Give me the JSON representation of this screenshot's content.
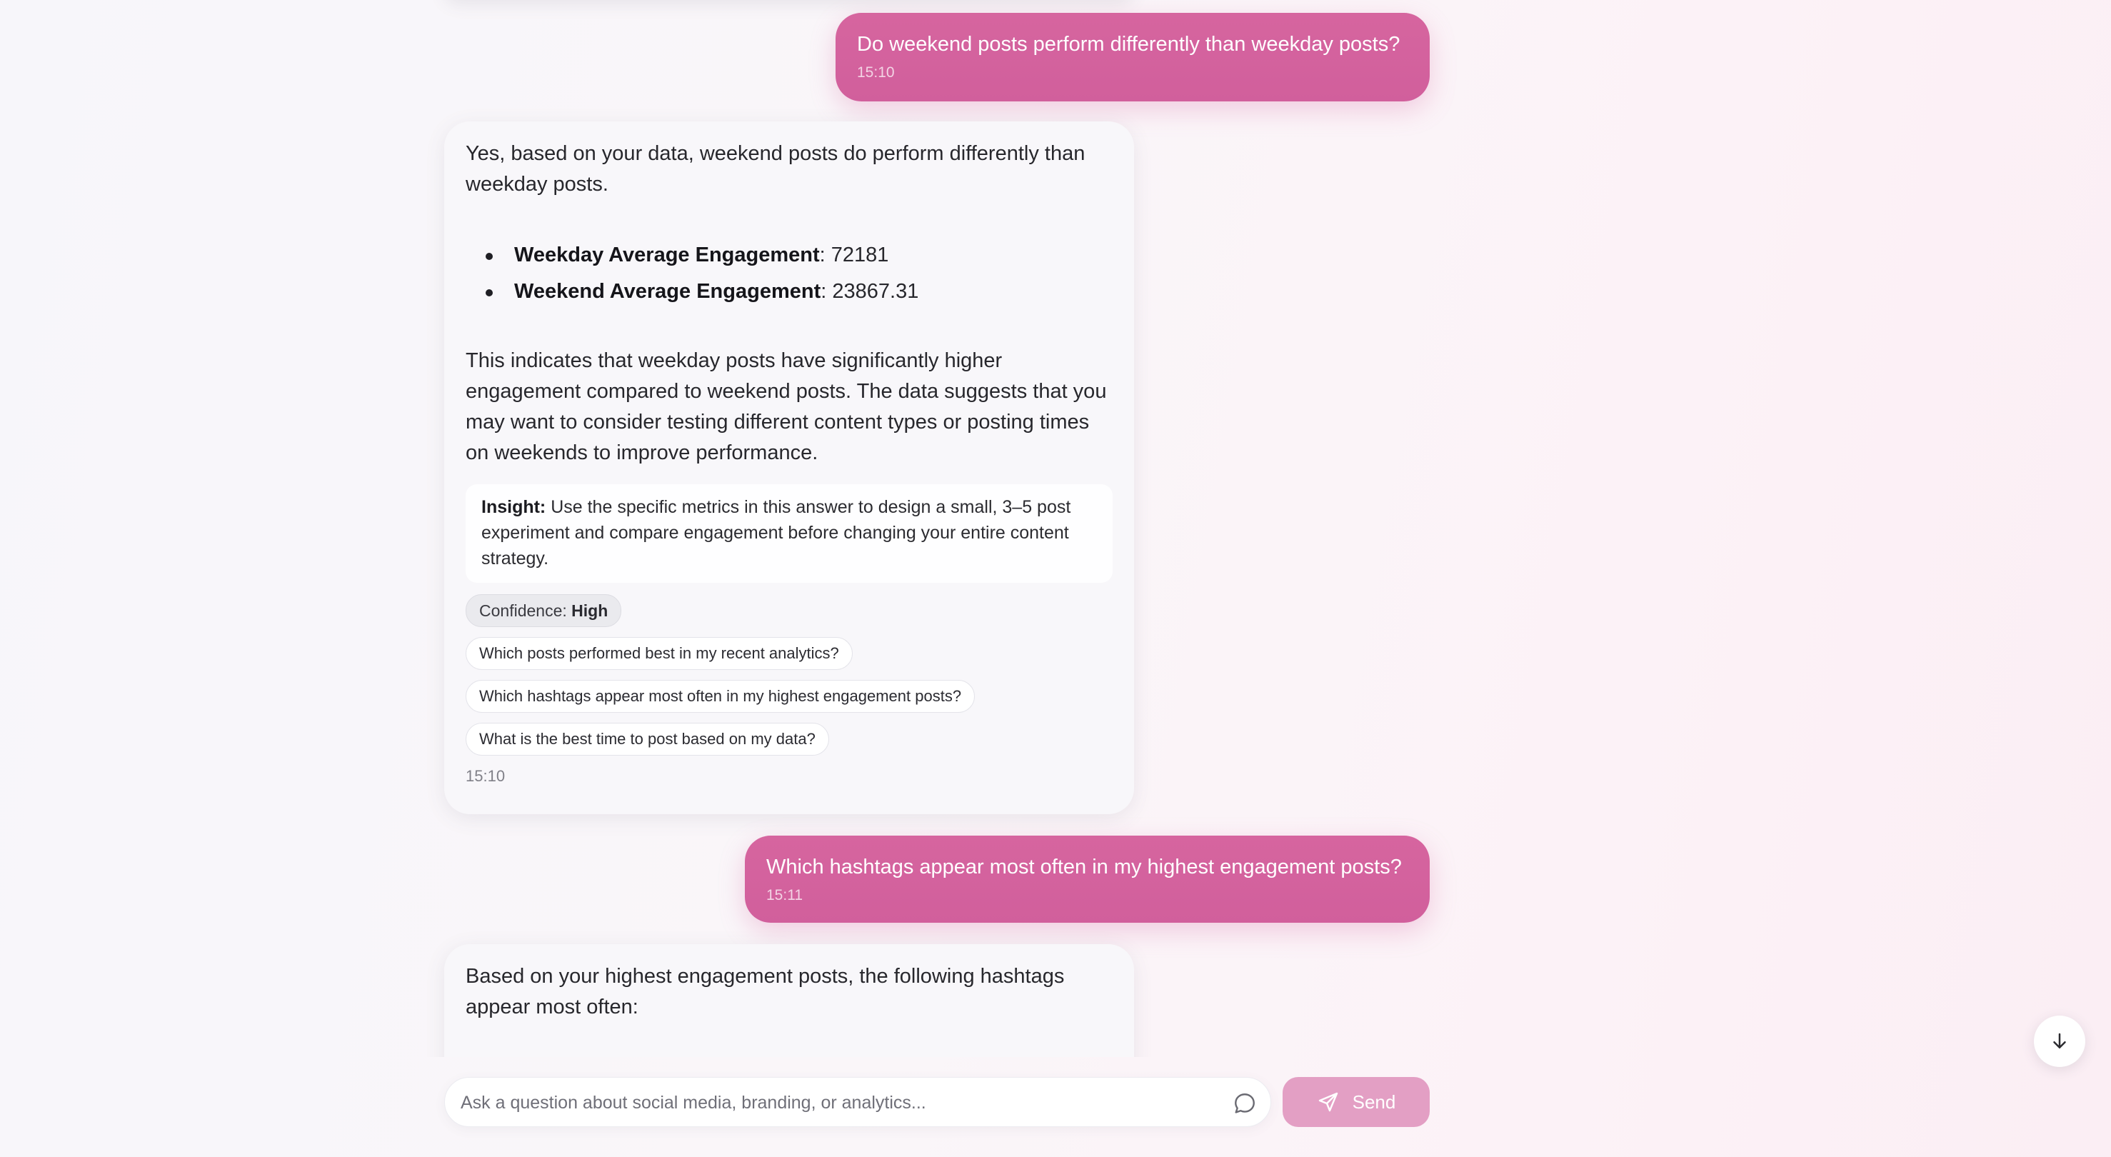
{
  "messages": {
    "user_1": {
      "text": "Do weekend posts perform differently than weekday posts?",
      "time": "15:10"
    },
    "bot_1": {
      "intro": "Yes, based on your data, weekend posts do perform differently than weekday posts.",
      "metrics": [
        {
          "label": "Weekday Average Engagement",
          "value": ": 72181"
        },
        {
          "label": "Weekend Average Engagement",
          "value": ": 23867.31"
        }
      ],
      "conclusion": "This indicates that weekday posts have significantly higher engagement compared to weekend posts. The data suggests that you may want to consider testing different content types or posting times on weekends to improve performance.",
      "insight_label": "Insight:",
      "insight_text": " Use the specific metrics in this answer to design a small, 3–5 post experiment and compare engagement before changing your entire content strategy.",
      "confidence_label": "Confidence: ",
      "confidence_value": "High",
      "suggestions": [
        "Which posts performed best in my recent analytics?",
        "Which hashtags appear most often in my highest engagement posts?",
        "What is the best time to post based on my data?"
      ],
      "time": "15:10"
    },
    "user_2": {
      "text": "Which hashtags appear most often in my highest engagement posts?",
      "time": "15:11"
    },
    "bot_2": {
      "intro": "Based on your highest engagement posts, the following hashtags appear most often:"
    }
  },
  "composer": {
    "placeholder": "Ask a question about social media, branding, or analytics...",
    "value": "",
    "chat_icon": "chat-bubble-icon",
    "send_label": "Send",
    "send_icon": "paper-plane-icon"
  },
  "scroll_button": {
    "icon": "arrow-down-icon"
  },
  "colors": {
    "user_bubble": "#d2609e",
    "send_button": "#e39fc4",
    "bot_bubble": "#f8f7fa"
  }
}
